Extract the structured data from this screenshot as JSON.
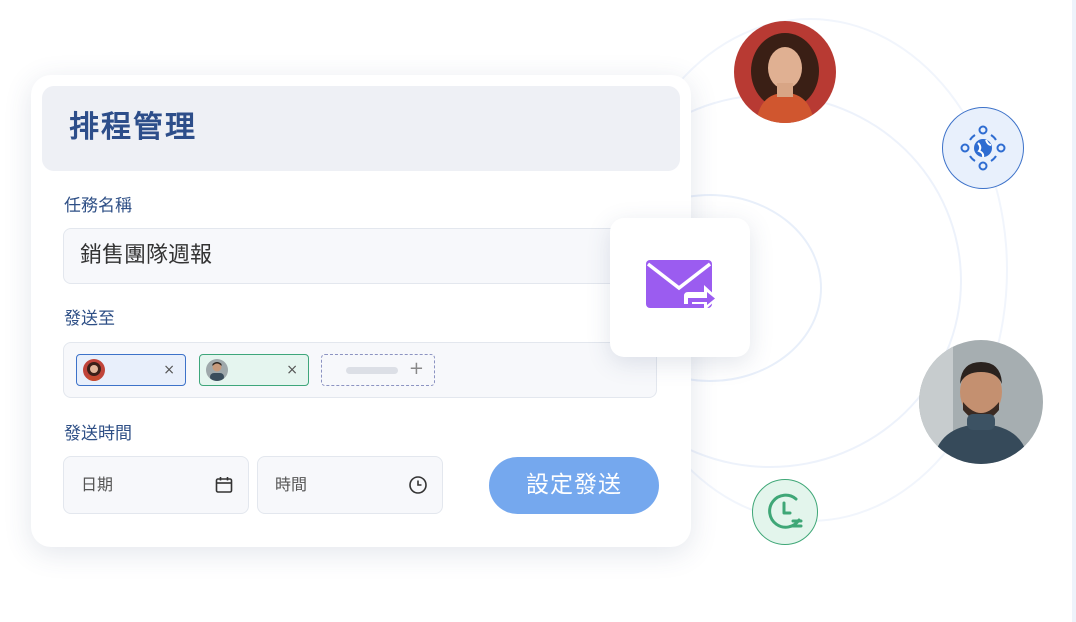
{
  "card": {
    "title": "排程管理",
    "task_label": "任務名稱",
    "task_value": "銷售團隊週報",
    "recipients_label": "發送至",
    "recipients": [
      {
        "avatar": "avatar-woman-icon",
        "remove": "×"
      },
      {
        "avatar": "avatar-man-icon",
        "remove": "×"
      }
    ],
    "add_recipient": "+",
    "send_time_label": "發送時間",
    "date_placeholder": "日期",
    "time_placeholder": "時間",
    "submit_label": "設定發送"
  },
  "icons": {
    "mail_forward": "mail-forward-icon",
    "calendar": "calendar-icon",
    "clock": "clock-icon",
    "globe": "globe-network-icon",
    "schedule_clock": "schedule-clock-icon"
  },
  "colors": {
    "accent_blue": "#2d4e8a",
    "button": "#75a8ee",
    "mail_purple": "#9b5cf0",
    "green": "#3fa777"
  }
}
